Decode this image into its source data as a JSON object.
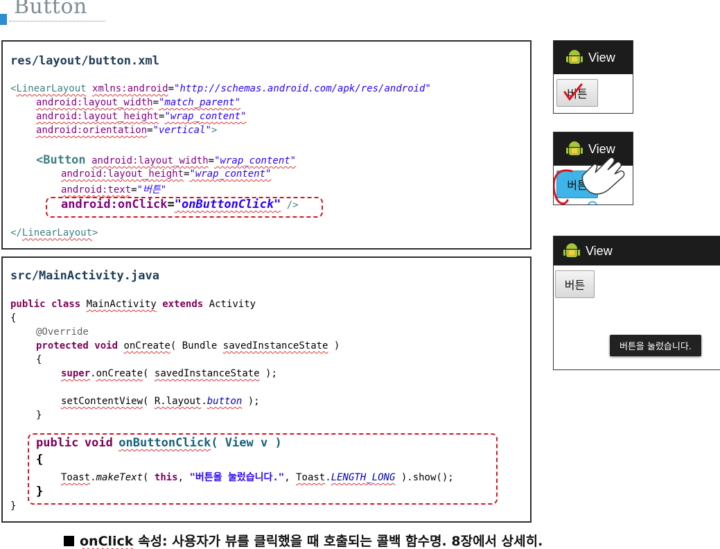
{
  "slide": {
    "title": "Button"
  },
  "xml": {
    "file": "res/layout/button.xml",
    "ll_open": "LinearLayout",
    "xmlns_attr": "xmlns:android",
    "xmlns_val": "\"http://schemas.android.com/apk/res/android\"",
    "lw_attr": "android:layout_width",
    "lw_val": "\"match_parent\"",
    "lh_attr": "android:layout_height",
    "lh_val": "\"wrap_content\"",
    "or_attr": "android:orientation",
    "or_val": "\"vertical\"",
    "btn_tag": "<Button",
    "blw_attr": "android:layout_width",
    "blw_val": "\"wrap_content\"",
    "blh_attr": "android:layout_height",
    "blh_val": "\"wrap_content\"",
    "bt_attr": "android:text",
    "bt_val": "\"버튼\"",
    "oc_attr": "android:onClick",
    "oc_val": "\"onButtonClick\"",
    "ll_close": "LinearLayout"
  },
  "java": {
    "file": "src/MainActivity.java",
    "kw_public": "public",
    "kw_class": "class",
    "class_name": "MainActivity",
    "kw_extends": "extends",
    "parent": "Activity",
    "brace_open": "{",
    "override": "@Override",
    "kw_protected": "protected",
    "kw_void": "void",
    "method": "onCreate",
    "bundle": "Bundle",
    "param": "savedInstanceState",
    "kw_super": "super",
    "set_content": "setContentView",
    "r_layout": "R.layout",
    "layout_name": "button",
    "brace_close": "}",
    "click_public": "public",
    "click_void": "void",
    "click_method": "onButtonClick",
    "click_param": "View v",
    "toast": "Toast",
    "make_text": "makeText",
    "kw_this": "this",
    "toast_msg": "\"버튼을 눌렀습니다.\"",
    "toast_class": "Toast",
    "length_long": "LENGTH_LONG",
    "show": ").show();"
  },
  "phones": {
    "app_title": "View",
    "button_label": "버튼",
    "toast_text": "버튼을 눌렀습니다."
  },
  "caption": {
    "prop": "onClick",
    "rest": " 속성: 사용자가 뷰를 클릭했을 때 호출되는 콜백 함수명. 8장에서 상세히."
  },
  "colors": {
    "accent": "#2a8ed0",
    "highlight": "#e0101a",
    "pressed": "#3fb4e8"
  }
}
